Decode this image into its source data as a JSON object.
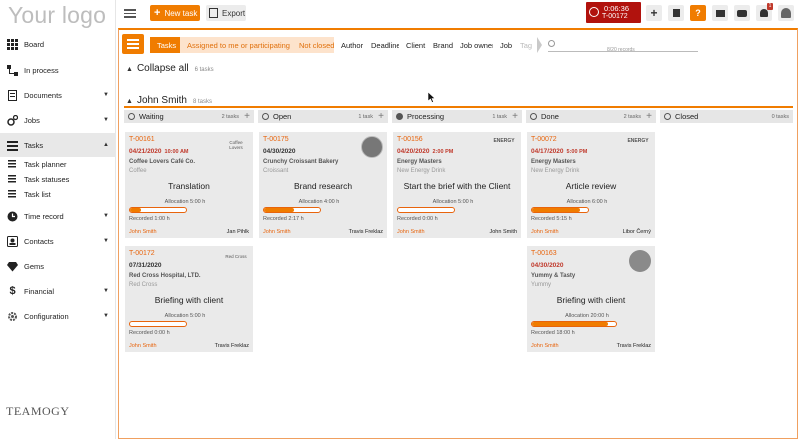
{
  "app": {
    "logo_text": "Your logo",
    "footer_logo": "TEAMOGY"
  },
  "topbar": {
    "new_task_label": "New task",
    "export_label": "Export",
    "timer_time": "0:06:36",
    "timer_task": "T-00172",
    "notifications_count": "1"
  },
  "sidebar": {
    "items": [
      {
        "label": "Board",
        "icon": "grid-icon"
      },
      {
        "label": "In process",
        "icon": "flow-icon"
      },
      {
        "label": "Documents",
        "icon": "document-icon"
      },
      {
        "label": "Jobs",
        "icon": "gears-icon"
      },
      {
        "label": "Tasks",
        "icon": "tasks-icon"
      },
      {
        "label": "Task planner",
        "icon": "list-icon"
      },
      {
        "label": "Task statuses",
        "icon": "list-icon"
      },
      {
        "label": "Task list",
        "icon": "list-icon"
      },
      {
        "label": "Time record",
        "icon": "clock-icon"
      },
      {
        "label": "Contacts",
        "icon": "contacts-icon"
      },
      {
        "label": "Gems",
        "icon": "gem-icon"
      },
      {
        "label": "Financial",
        "icon": "dollar-icon"
      },
      {
        "label": "Configuration",
        "icon": "gear-icon"
      }
    ]
  },
  "filters": {
    "crumbs": [
      "Tasks",
      "Assigned to me or participating in",
      "Not closed",
      "Author",
      "Deadline",
      "Client",
      "Brand",
      "Job owner",
      "Job",
      "Tag"
    ],
    "records_text": "8/20 records",
    "search_value": ""
  },
  "board": {
    "collapse_label": "Collapse all",
    "collapse_count": "6 tasks",
    "group_name": "John Smith",
    "group_count": "8 tasks",
    "columns": [
      {
        "label": "Waiting",
        "count": "2 tasks"
      },
      {
        "label": "Open",
        "count": "1 task"
      },
      {
        "label": "Processing",
        "count": "1 task"
      },
      {
        "label": "Done",
        "count": "2 tasks"
      },
      {
        "label": "Closed",
        "count": "0 tasks"
      }
    ],
    "cards": [
      {
        "id": "T-00161",
        "date": "04/21/2020",
        "time": "10:00 AM",
        "client": "Coffee Lovers Café Co.",
        "brand": "Coffee",
        "title": "Translation",
        "allocation": "Allocation 5:00 h",
        "progress": 0.2,
        "recorded": "Recorded 1:00 h",
        "owner": "John Smith",
        "assignee": "Jan Pihlk",
        "logo": "Coffee Lovers"
      },
      {
        "id": "T-00175",
        "date": "04/30/2020",
        "time": "",
        "client": "Crunchy Croissant Bakery",
        "brand": "Croissant",
        "title": "Brand research",
        "allocation": "Allocation 4:00 h",
        "progress": 0.54,
        "recorded": "Recorded 2:17 h",
        "owner": "John Smith",
        "assignee": "Travis Freklaz",
        "logo": ""
      },
      {
        "id": "T-00156",
        "date": "04/20/2020",
        "time": "2:00 PM",
        "client": "Energy Masters",
        "brand": "New Energy Drink",
        "title": "Start the brief with the Client",
        "allocation": "Allocation 5:00 h",
        "progress": 0.0,
        "recorded": "Recorded 0:00 h",
        "owner": "John Smith",
        "assignee": "John Smith",
        "logo": "ENERGY"
      },
      {
        "id": "T-00072",
        "date": "04/17/2020",
        "time": "5:00 PM",
        "client": "Energy Masters",
        "brand": "New Energy Drink",
        "title": "Article review",
        "allocation": "Allocation 6:00 h",
        "progress": 0.86,
        "recorded": "Recorded 5:15 h",
        "owner": "John Smith",
        "assignee": "Libor Černý",
        "logo": "ENERGY"
      },
      {
        "id": "T-00172",
        "date": "07/31/2020",
        "time": "",
        "client": "Red Cross Hospital, LTD.",
        "brand": "Red Cross",
        "title": "Briefing with client",
        "allocation": "Allocation 5:00 h",
        "progress": 0.0,
        "recorded": "Recorded 0:00 h",
        "owner": "John Smith",
        "assignee": "Travis Freklaz",
        "logo": "Red Cross"
      },
      {
        "id": "T-00163",
        "date": "04/30/2020",
        "time": "",
        "client": "Yummy & Tasty",
        "brand": "Yummy",
        "title": "Briefing with client",
        "allocation": "Allocation 20:00 h",
        "progress": 0.9,
        "recorded": "Recorded 18:00 h",
        "owner": "John Smith",
        "assignee": "Travis Freklaz",
        "logo": ""
      }
    ]
  },
  "colors": {
    "accent": "#f07c00",
    "overdue": "#c0392b",
    "timer": "#b1120d"
  }
}
